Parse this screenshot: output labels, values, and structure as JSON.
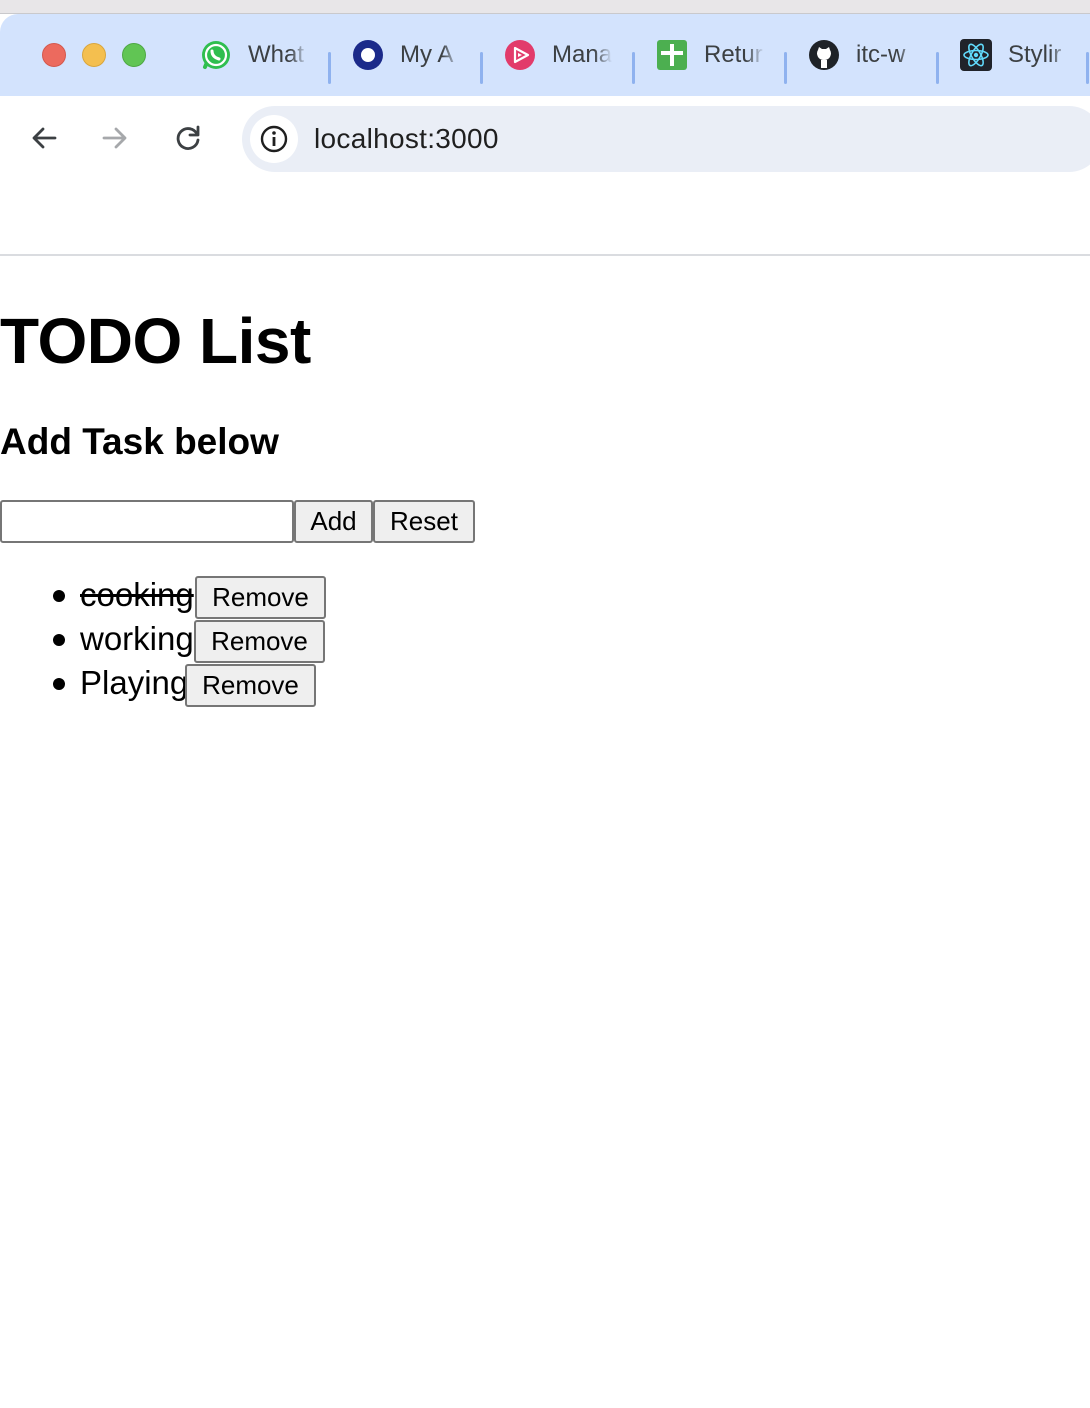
{
  "browser": {
    "tabs": [
      {
        "title": "What",
        "icon": "whatsapp-icon"
      },
      {
        "title": "My A",
        "icon": "circle-ring-icon"
      },
      {
        "title": "Mana",
        "icon": "play-badge-icon"
      },
      {
        "title": "Retur",
        "icon": "green-plus-icon"
      },
      {
        "title": "itc-w",
        "icon": "github-icon"
      },
      {
        "title": "Stylir",
        "icon": "react-icon"
      }
    ],
    "url": "localhost:3000"
  },
  "page": {
    "title": "TODO List",
    "subtitle": "Add Task below",
    "input": {
      "value": "",
      "placeholder": ""
    },
    "add_label": "Add",
    "reset_label": "Reset",
    "todos": [
      {
        "text": "cooking",
        "done": true,
        "remove_label": "Remove"
      },
      {
        "text": "working",
        "done": false,
        "remove_label": "Remove"
      },
      {
        "text": "Playing",
        "done": false,
        "remove_label": "Remove"
      }
    ]
  },
  "colors": {
    "tabstrip": "#d3e3fd",
    "omnibox": "#eaeef6",
    "button_bg": "#efefef",
    "button_border": "#767676"
  }
}
